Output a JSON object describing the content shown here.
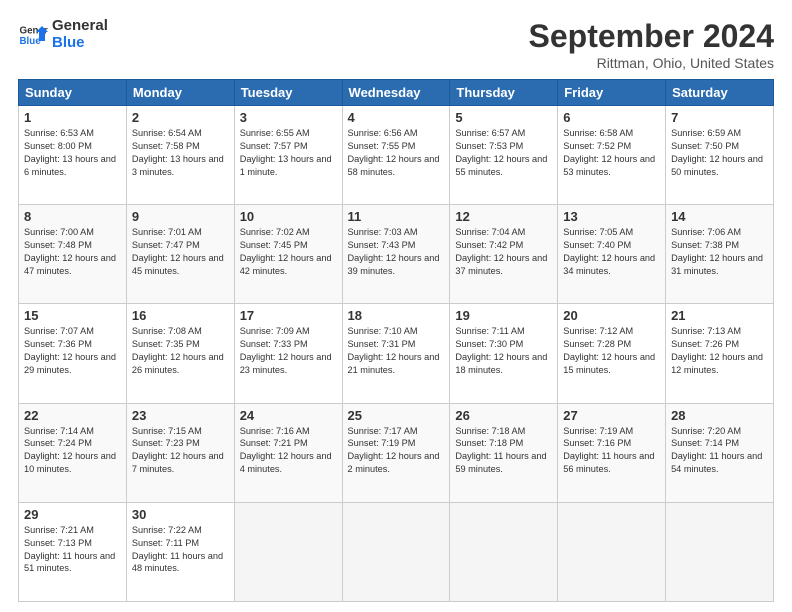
{
  "logo": {
    "line1": "General",
    "line2": "Blue"
  },
  "title": "September 2024",
  "subtitle": "Rittman, Ohio, United States",
  "headers": [
    "Sunday",
    "Monday",
    "Tuesday",
    "Wednesday",
    "Thursday",
    "Friday",
    "Saturday"
  ],
  "weeks": [
    [
      {
        "day": "1",
        "sunrise": "6:53 AM",
        "sunset": "8:00 PM",
        "daylight": "13 hours and 6 minutes."
      },
      {
        "day": "2",
        "sunrise": "6:54 AM",
        "sunset": "7:58 PM",
        "daylight": "13 hours and 3 minutes."
      },
      {
        "day": "3",
        "sunrise": "6:55 AM",
        "sunset": "7:57 PM",
        "daylight": "13 hours and 1 minute."
      },
      {
        "day": "4",
        "sunrise": "6:56 AM",
        "sunset": "7:55 PM",
        "daylight": "12 hours and 58 minutes."
      },
      {
        "day": "5",
        "sunrise": "6:57 AM",
        "sunset": "7:53 PM",
        "daylight": "12 hours and 55 minutes."
      },
      {
        "day": "6",
        "sunrise": "6:58 AM",
        "sunset": "7:52 PM",
        "daylight": "12 hours and 53 minutes."
      },
      {
        "day": "7",
        "sunrise": "6:59 AM",
        "sunset": "7:50 PM",
        "daylight": "12 hours and 50 minutes."
      }
    ],
    [
      {
        "day": "8",
        "sunrise": "7:00 AM",
        "sunset": "7:48 PM",
        "daylight": "12 hours and 47 minutes."
      },
      {
        "day": "9",
        "sunrise": "7:01 AM",
        "sunset": "7:47 PM",
        "daylight": "12 hours and 45 minutes."
      },
      {
        "day": "10",
        "sunrise": "7:02 AM",
        "sunset": "7:45 PM",
        "daylight": "12 hours and 42 minutes."
      },
      {
        "day": "11",
        "sunrise": "7:03 AM",
        "sunset": "7:43 PM",
        "daylight": "12 hours and 39 minutes."
      },
      {
        "day": "12",
        "sunrise": "7:04 AM",
        "sunset": "7:42 PM",
        "daylight": "12 hours and 37 minutes."
      },
      {
        "day": "13",
        "sunrise": "7:05 AM",
        "sunset": "7:40 PM",
        "daylight": "12 hours and 34 minutes."
      },
      {
        "day": "14",
        "sunrise": "7:06 AM",
        "sunset": "7:38 PM",
        "daylight": "12 hours and 31 minutes."
      }
    ],
    [
      {
        "day": "15",
        "sunrise": "7:07 AM",
        "sunset": "7:36 PM",
        "daylight": "12 hours and 29 minutes."
      },
      {
        "day": "16",
        "sunrise": "7:08 AM",
        "sunset": "7:35 PM",
        "daylight": "12 hours and 26 minutes."
      },
      {
        "day": "17",
        "sunrise": "7:09 AM",
        "sunset": "7:33 PM",
        "daylight": "12 hours and 23 minutes."
      },
      {
        "day": "18",
        "sunrise": "7:10 AM",
        "sunset": "7:31 PM",
        "daylight": "12 hours and 21 minutes."
      },
      {
        "day": "19",
        "sunrise": "7:11 AM",
        "sunset": "7:30 PM",
        "daylight": "12 hours and 18 minutes."
      },
      {
        "day": "20",
        "sunrise": "7:12 AM",
        "sunset": "7:28 PM",
        "daylight": "12 hours and 15 minutes."
      },
      {
        "day": "21",
        "sunrise": "7:13 AM",
        "sunset": "7:26 PM",
        "daylight": "12 hours and 12 minutes."
      }
    ],
    [
      {
        "day": "22",
        "sunrise": "7:14 AM",
        "sunset": "7:24 PM",
        "daylight": "12 hours and 10 minutes."
      },
      {
        "day": "23",
        "sunrise": "7:15 AM",
        "sunset": "7:23 PM",
        "daylight": "12 hours and 7 minutes."
      },
      {
        "day": "24",
        "sunrise": "7:16 AM",
        "sunset": "7:21 PM",
        "daylight": "12 hours and 4 minutes."
      },
      {
        "day": "25",
        "sunrise": "7:17 AM",
        "sunset": "7:19 PM",
        "daylight": "12 hours and 2 minutes."
      },
      {
        "day": "26",
        "sunrise": "7:18 AM",
        "sunset": "7:18 PM",
        "daylight": "11 hours and 59 minutes."
      },
      {
        "day": "27",
        "sunrise": "7:19 AM",
        "sunset": "7:16 PM",
        "daylight": "11 hours and 56 minutes."
      },
      {
        "day": "28",
        "sunrise": "7:20 AM",
        "sunset": "7:14 PM",
        "daylight": "11 hours and 54 minutes."
      }
    ],
    [
      {
        "day": "29",
        "sunrise": "7:21 AM",
        "sunset": "7:13 PM",
        "daylight": "11 hours and 51 minutes."
      },
      {
        "day": "30",
        "sunrise": "7:22 AM",
        "sunset": "7:11 PM",
        "daylight": "11 hours and 48 minutes."
      },
      null,
      null,
      null,
      null,
      null
    ]
  ]
}
